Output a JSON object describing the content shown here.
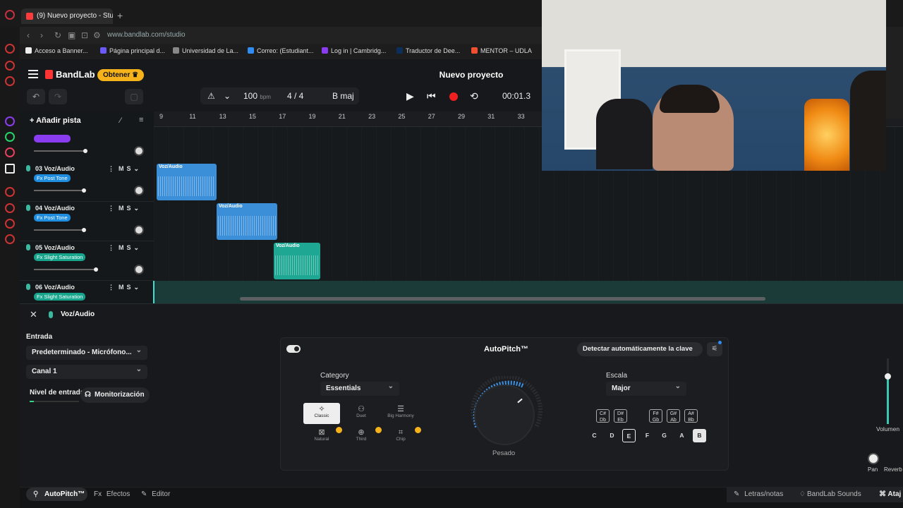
{
  "browser": {
    "tab_title": "(9) Nuevo proyecto - Studi",
    "url": "www.bandlab.com/studio",
    "bookmarks": [
      {
        "label": "Acceso a Banner...",
        "color": "#f0f0f0"
      },
      {
        "label": "Página principal d...",
        "color": "#6a5af9"
      },
      {
        "label": "Universidad de La...",
        "color": "#888888"
      },
      {
        "label": "Correo: (Estudiant...",
        "color": "#2f8cf0"
      },
      {
        "label": "Log in | Cambridg...",
        "color": "#8a3cf0"
      },
      {
        "label": "Traductor de Dee...",
        "color": "#0b2f5a"
      },
      {
        "label": "MENTOR – UDLA",
        "color": "#f05030"
      }
    ]
  },
  "header": {
    "logo": "BandLab",
    "cta": "Obtener",
    "project_title": "Nuevo proyecto"
  },
  "transport": {
    "bpm": "100",
    "bpm_unit": "bpm",
    "time_sig": "4 / 4",
    "key": "B maj",
    "time": "00:01.3"
  },
  "tracks_header": {
    "add_track": "Añadir pista"
  },
  "ruler": [
    "9",
    "11",
    "13",
    "15",
    "17",
    "19",
    "21",
    "23",
    "25",
    "27",
    "29",
    "31",
    "33"
  ],
  "tracks": [
    {
      "name": "03  Voz/Audio",
      "fx": "Fx Post Tone",
      "fx_color": "#1f8de0",
      "mute": "M",
      "solo": "S"
    },
    {
      "name": "04  Voz/Audio",
      "fx": "Fx Post Tone",
      "fx_color": "#1f8de0",
      "mute": "M",
      "solo": "S"
    },
    {
      "name": "05  Voz/Audio",
      "fx": "Fx Slight Saturation",
      "fx_color": "#16a58c",
      "mute": "M",
      "solo": "S"
    },
    {
      "name": "06  Voz/Audio",
      "fx": "Fx Slight Saturation",
      "fx_color": "#16a58c",
      "mute": "M",
      "solo": "S"
    }
  ],
  "clips": [
    {
      "label": "Voz/Audio",
      "color": "#3b8fd8"
    },
    {
      "label": "Voz/Audio",
      "color": "#3b8fd8"
    },
    {
      "label": "Voz/Audio",
      "color": "#1ea894"
    }
  ],
  "panel": {
    "title": "Voz/Audio",
    "input_label": "Entrada",
    "input_device": "Predeterminado - Micrófono...",
    "channel": "Canal 1",
    "level_label": "Nivel de entrada",
    "monitor": "Monitorización"
  },
  "autopitch": {
    "title": "AutoPitch™",
    "detect": "Detectar automáticamente la clave",
    "category_label": "Category",
    "category_value": "Essentials",
    "scale_label": "Escala",
    "scale_value": "Major",
    "dial_label": "Pesado",
    "modes": [
      {
        "label": "Classic",
        "icon": "✧"
      },
      {
        "label": "Duet",
        "icon": "⚇"
      },
      {
        "label": "Big Harmony",
        "icon": "☰"
      },
      {
        "label": "Natural",
        "icon": "⊠"
      },
      {
        "label": "Third",
        "icon": "⊕"
      },
      {
        "label": "Chip",
        "icon": "⌗"
      }
    ],
    "accidentals": [
      "C# Db",
      "D# Eb",
      "F# Gb",
      "G# Ab",
      "A# Bb"
    ],
    "notes": [
      "C",
      "D",
      "E",
      "F",
      "G",
      "A",
      "B"
    ]
  },
  "mixer": {
    "volume": "Volumen",
    "pan": "Pan",
    "reverb": "Reverb"
  },
  "bottom_bar": {
    "autopitch": "AutoPitch™",
    "effects": "Efectos",
    "editor": "Editor",
    "lyrics": "Letras/notas",
    "sounds": "BandLab Sounds",
    "shortcuts": "Ataj"
  }
}
